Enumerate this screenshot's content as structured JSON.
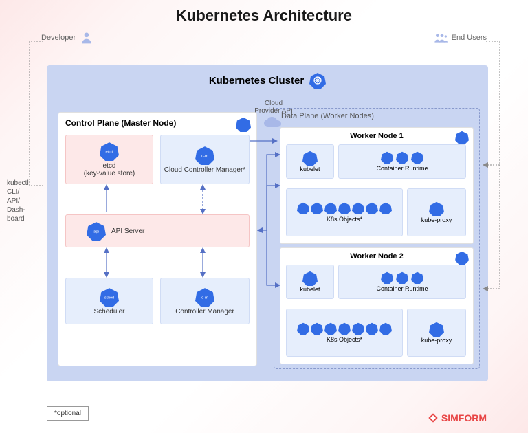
{
  "title": "Kubernetes Architecture",
  "actors": {
    "developer": "Developer",
    "endusers": "End Users"
  },
  "cluster": {
    "title": "Kubernetes Cluster"
  },
  "cloud_api": "Cloud Provider API",
  "control_plane": {
    "title": "Control Plane (Master Node)",
    "etcd": {
      "label": "etcd",
      "sub": "(key-value store)",
      "icon": "etcd"
    },
    "ccm": {
      "label": "Cloud Controller Manager*",
      "icon": "c-m"
    },
    "api": {
      "label": "API Server",
      "icon": "api"
    },
    "sched": {
      "label": "Scheduler",
      "icon": "sched"
    },
    "cm": {
      "label": "Controller Manager",
      "icon": "c-m"
    }
  },
  "data_plane": {
    "title": "Data Plane (Worker Nodes)",
    "workers": [
      {
        "title": "Worker Node 1",
        "kubelet": "kubelet",
        "runtime": "Container Runtime",
        "k8sobj": "K8s Objects*",
        "kproxy": "kube-proxy",
        "node_icon": "node",
        "kubelet_icon": "kubelet",
        "kproxy_icon": "k-proxy"
      },
      {
        "title": "Worker Node 2",
        "kubelet": "kubelet",
        "runtime": "Container Runtime",
        "k8sobj": "K8s Objects*",
        "kproxy": "kube-proxy",
        "node_icon": "node",
        "kubelet_icon": "kubelet",
        "kproxy_icon": "k-proxy"
      }
    ]
  },
  "kubectl": {
    "line1": "kubectl",
    "line2": "CLI/",
    "line3": "API/",
    "line4": "Dash-",
    "line5": "board"
  },
  "optional": "*optional",
  "brand": "SIMFORM"
}
